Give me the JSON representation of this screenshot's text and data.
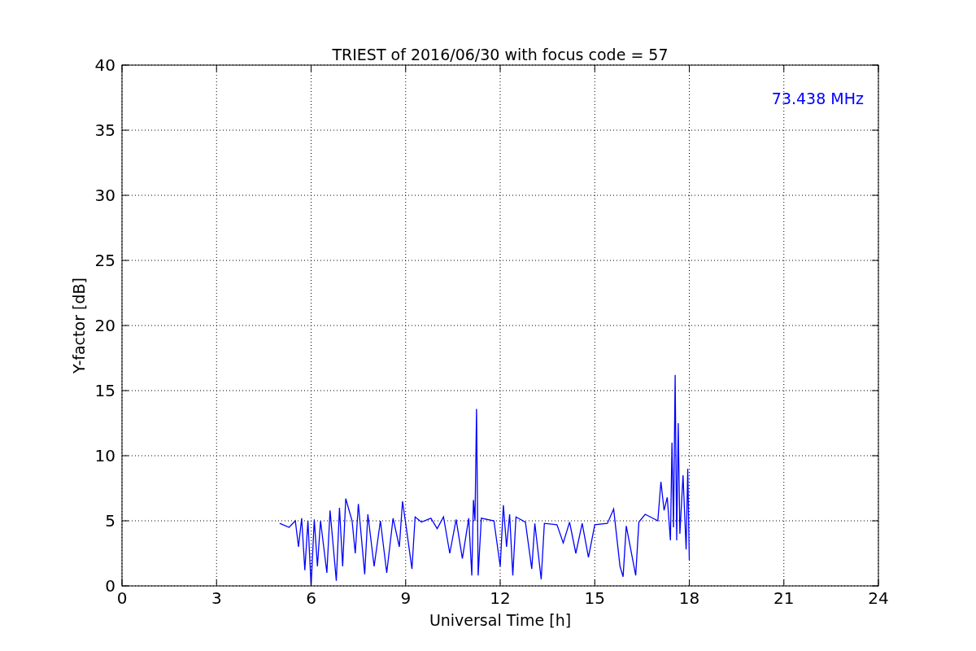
{
  "chart_data": {
    "type": "line",
    "title": "TRIEST of 2016/06/30 with focus code = 57",
    "xlabel": "Universal Time [h]",
    "ylabel": "Y-factor [dB]",
    "x": [
      5.0,
      5.3,
      5.5,
      5.6,
      5.7,
      5.8,
      5.9,
      6.0,
      6.1,
      6.2,
      6.3,
      6.5,
      6.6,
      6.8,
      6.9,
      7.0,
      7.1,
      7.3,
      7.4,
      7.5,
      7.7,
      7.8,
      8.0,
      8.2,
      8.4,
      8.6,
      8.8,
      8.9,
      9.0,
      9.2,
      9.3,
      9.5,
      9.8,
      10.0,
      10.2,
      10.4,
      10.6,
      10.8,
      11.0,
      11.1,
      11.15,
      11.2,
      11.25,
      11.3,
      11.4,
      11.8,
      12.0,
      12.1,
      12.2,
      12.3,
      12.4,
      12.5,
      12.8,
      13.0,
      13.1,
      13.3,
      13.4,
      13.8,
      14.0,
      14.2,
      14.4,
      14.6,
      14.8,
      15.0,
      15.4,
      15.6,
      15.8,
      15.9,
      16.0,
      16.3,
      16.4,
      16.6,
      17.0,
      17.1,
      17.2,
      17.3,
      17.4,
      17.45,
      17.5,
      17.55,
      17.6,
      17.65,
      17.7,
      17.8,
      17.9,
      17.95,
      18.0
    ],
    "series": [
      {
        "name": "73.438 MHz",
        "color": "#0000ff",
        "values": [
          4.8,
          4.5,
          5.0,
          3.0,
          5.2,
          1.2,
          5.0,
          0.0,
          5.1,
          1.5,
          5.0,
          1.0,
          5.8,
          0.4,
          6.0,
          1.5,
          6.7,
          5.0,
          2.5,
          6.3,
          0.9,
          5.5,
          1.5,
          5.0,
          1.0,
          5.2,
          3.0,
          6.5,
          4.8,
          1.3,
          5.3,
          4.9,
          5.2,
          4.4,
          5.3,
          2.5,
          5.1,
          2.1,
          5.2,
          0.8,
          6.6,
          5.0,
          13.6,
          0.8,
          5.2,
          5.0,
          1.5,
          6.2,
          3.0,
          5.5,
          0.8,
          5.3,
          4.9,
          1.3,
          4.8,
          0.5,
          4.8,
          4.7,
          3.3,
          4.9,
          2.5,
          4.8,
          2.2,
          4.7,
          4.8,
          5.9,
          1.5,
          0.7,
          4.6,
          0.8,
          4.9,
          5.5,
          5.0,
          8.0,
          5.8,
          6.8,
          3.5,
          11.0,
          4.5,
          16.2,
          3.5,
          12.5,
          4.0,
          8.5,
          2.8,
          9.0,
          2.0
        ]
      }
    ],
    "xlim": [
      0,
      24
    ],
    "ylim": [
      0,
      40
    ],
    "xticks": [
      0,
      3,
      6,
      9,
      12,
      15,
      18,
      21,
      24
    ],
    "yticks": [
      0,
      5,
      10,
      15,
      20,
      25,
      30,
      35,
      40
    ],
    "grid": true
  }
}
